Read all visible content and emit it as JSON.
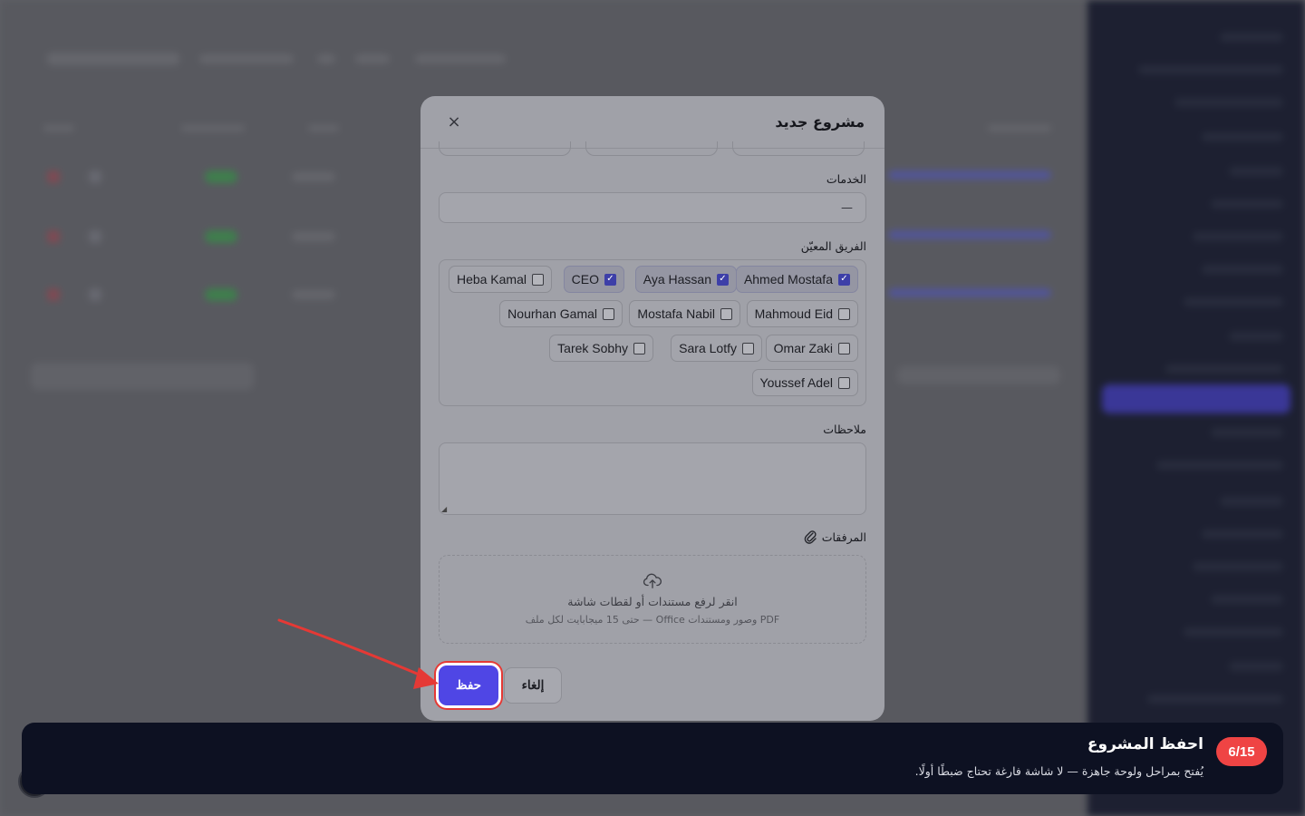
{
  "modal": {
    "title": "مشروع جديد",
    "close_label": "×",
    "services_label": "الخدمات",
    "services_value": "—",
    "team_label": "الفريق المعيّن",
    "team_members": [
      {
        "name": "Ahmed Mostafa",
        "checked": true
      },
      {
        "name": "Aya Hassan",
        "checked": true
      },
      {
        "name": "CEO",
        "checked": true
      },
      {
        "name": "Heba Kamal",
        "checked": false
      },
      {
        "name": "Mahmoud Eid",
        "checked": false
      },
      {
        "name": "Mostafa Nabil",
        "checked": false
      },
      {
        "name": "Nourhan Gamal",
        "checked": false
      },
      {
        "name": "Omar Zaki",
        "checked": false
      },
      {
        "name": "Sara Lotfy",
        "checked": false
      },
      {
        "name": "Tarek Sobhy",
        "checked": false
      },
      {
        "name": "Youssef Adel",
        "checked": false
      }
    ],
    "notes_label": "ملاحظات",
    "notes_value": "",
    "attachments_label": "المرفقات",
    "dropzone_title": "انقر لرفع مستندات أو لقطات شاشة",
    "dropzone_hint": "PDF وصور ومستندات Office — حتى 15 ميجابايت لكل ملف",
    "save_label": "حفظ",
    "cancel_label": "إلغاء"
  },
  "tour": {
    "step": "6/15",
    "title": "احفظ المشروع",
    "description": "يُفتح بمراحل ولوحة جاهزة — لا شاشة فارغة تحتاج ضبطًا أولًا."
  },
  "colors": {
    "primary": "#4f46e5",
    "highlight": "#e53935",
    "badge": "#ef4444",
    "tour_bg": "#0d1122"
  }
}
